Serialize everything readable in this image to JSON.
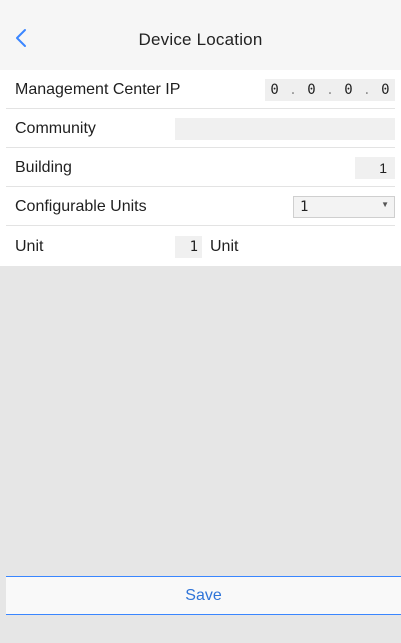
{
  "header": {
    "title": "Device Location",
    "back_icon": "chevron-left-icon"
  },
  "form": {
    "management_center_ip": {
      "label": "Management Center IP",
      "octets": [
        "0",
        "0",
        "0",
        "0"
      ],
      "separator": "."
    },
    "community": {
      "label": "Community",
      "value": ""
    },
    "building": {
      "label": "Building",
      "value": "1"
    },
    "configurable_units": {
      "label": "Configurable Units",
      "selected": "1"
    },
    "unit": {
      "label": "Unit",
      "value": "1",
      "suffix": "Unit"
    }
  },
  "footer": {
    "save_label": "Save"
  },
  "colors": {
    "accent": "#2f74d8",
    "accent_line": "#3a86ff",
    "page_background": "#e6e6e6",
    "header_background": "#f6f6f6"
  }
}
